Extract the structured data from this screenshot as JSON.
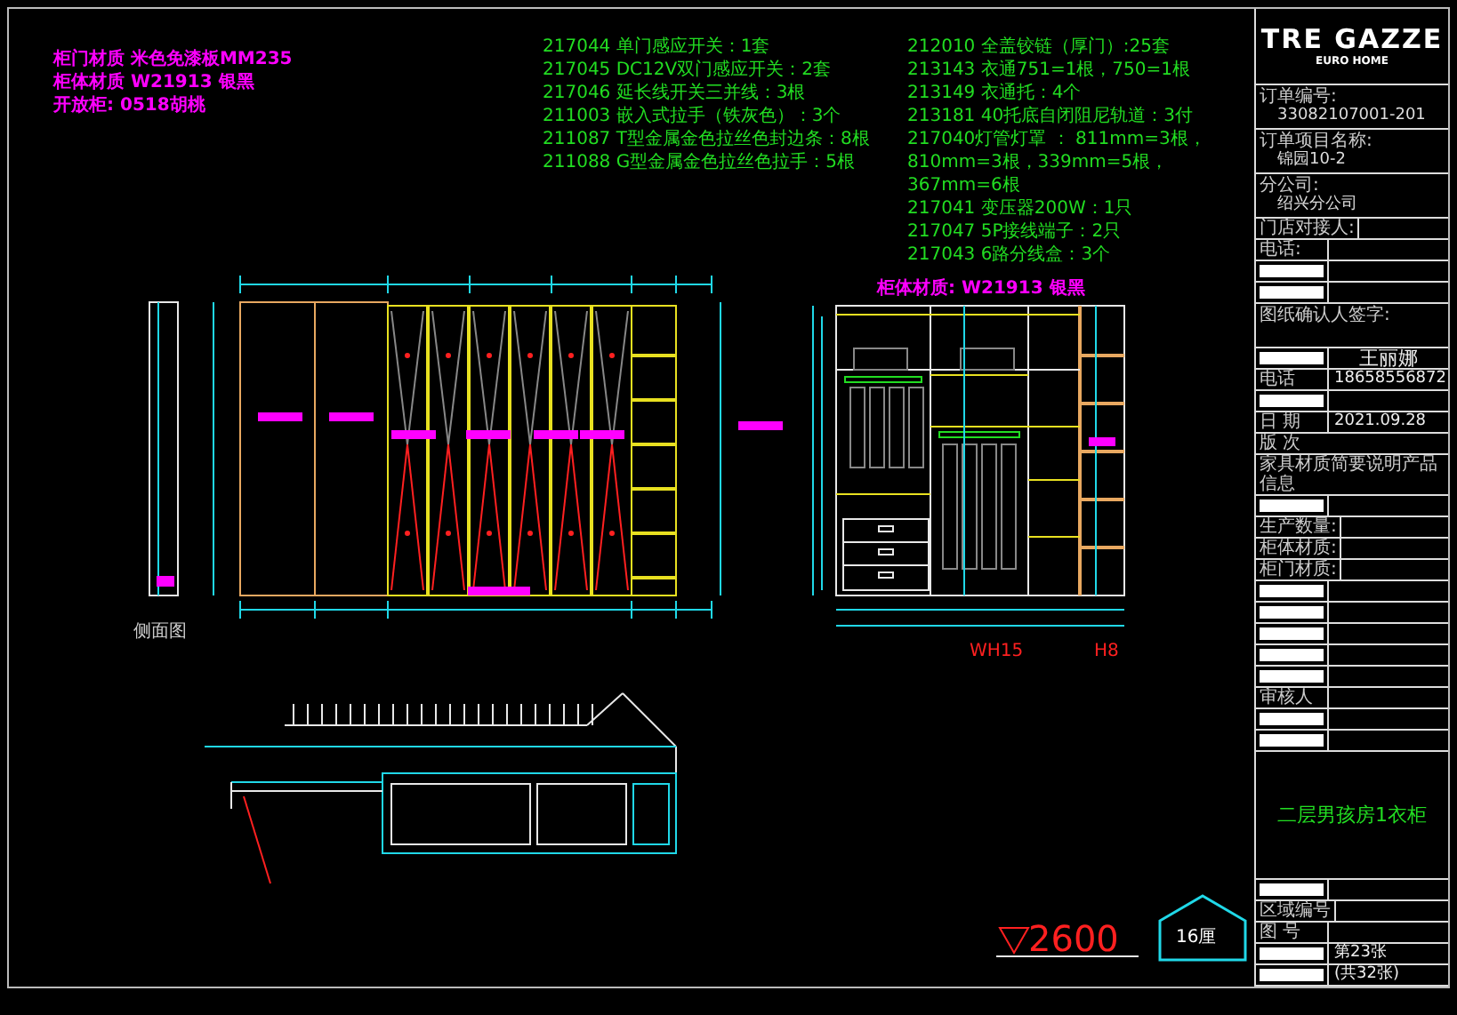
{
  "materials": [
    "柜门材质 米色免漆板MM235",
    "柜体材质 W21913 银黑",
    "开放柜: 0518胡桃"
  ],
  "hardware_list": {
    "column_1": [
      "217044 单门感应开关：1套",
      "217045 DC12V双门感应开关：2套",
      "217046 延长线开关三并线：3根",
      "211003 嵌入式拉手（铁灰色）：3个",
      "211087 T型金属金色拉丝色封边条：8根",
      "211088 G型金属金色拉丝色拉手：5根"
    ],
    "column_2": [
      "212010 全盖铰链（厚门）:25套",
      "213143 衣通751=1根，750=1根",
      "213149 衣通托：4个",
      "213181 40托底自闭阻尼轨道：3付",
      "217040灯管灯罩 ： 811mm=3根，810mm=3根，339mm=5根，367mm=6根",
      "217041 变压器200W：1只",
      "217047 5P接线端子：2只",
      "217043 6路分线盒：3个"
    ]
  },
  "views": {
    "side_view_label": "侧面图",
    "interior_label": "柜体材质: W21913 银黑",
    "interior_width_labels": [
      "WH15",
      "H8"
    ],
    "level_mark": "2600",
    "thickness_badge": "16厘"
  },
  "title_block": {
    "logo": "TRE GAZZE",
    "logo_sub": "EURO HOME",
    "rows": [
      {
        "kind": "stack",
        "label": "订单编号:",
        "value": "33082107001-201"
      },
      {
        "kind": "stack",
        "label": "订单项目名称:",
        "value": "锦园10-2"
      },
      {
        "kind": "stack",
        "label": "分公司:",
        "value": "绍兴分公司"
      },
      {
        "kind": "pair",
        "label": "门店对接人:"
      },
      {
        "kind": "pair",
        "label": "电话:"
      },
      {
        "kind": "redacted"
      },
      {
        "kind": "redacted"
      },
      {
        "kind": "tall",
        "label": "图纸确认人签字:"
      },
      {
        "kind": "redacted",
        "value": "王丽娜"
      },
      {
        "kind": "pair",
        "label": "电话",
        "value": "18658556872"
      },
      {
        "kind": "redacted"
      },
      {
        "kind": "pair",
        "label": "日 期",
        "value": "2021.09.28"
      },
      {
        "kind": "full",
        "label": "版 次"
      },
      {
        "kind": "full",
        "label": "家具材质简要说明产品信息"
      },
      {
        "kind": "redacted"
      },
      {
        "kind": "pair",
        "label": "生产数量:"
      },
      {
        "kind": "pair",
        "label": "柜体材质:"
      },
      {
        "kind": "pair",
        "label": "柜门材质:"
      },
      {
        "kind": "redacted"
      },
      {
        "kind": "redacted"
      },
      {
        "kind": "redacted"
      },
      {
        "kind": "redacted"
      },
      {
        "kind": "redacted"
      },
      {
        "kind": "pair",
        "label": "审核人"
      },
      {
        "kind": "redacted"
      },
      {
        "kind": "redacted"
      },
      {
        "kind": "title",
        "value": "二层男孩房1衣柜"
      },
      {
        "kind": "redacted"
      },
      {
        "kind": "pair",
        "label": "区域编号"
      },
      {
        "kind": "pair",
        "label": "图 号"
      },
      {
        "kind": "redacted",
        "value": "第23张"
      },
      {
        "kind": "redacted",
        "value": "(共32张)"
      }
    ]
  }
}
